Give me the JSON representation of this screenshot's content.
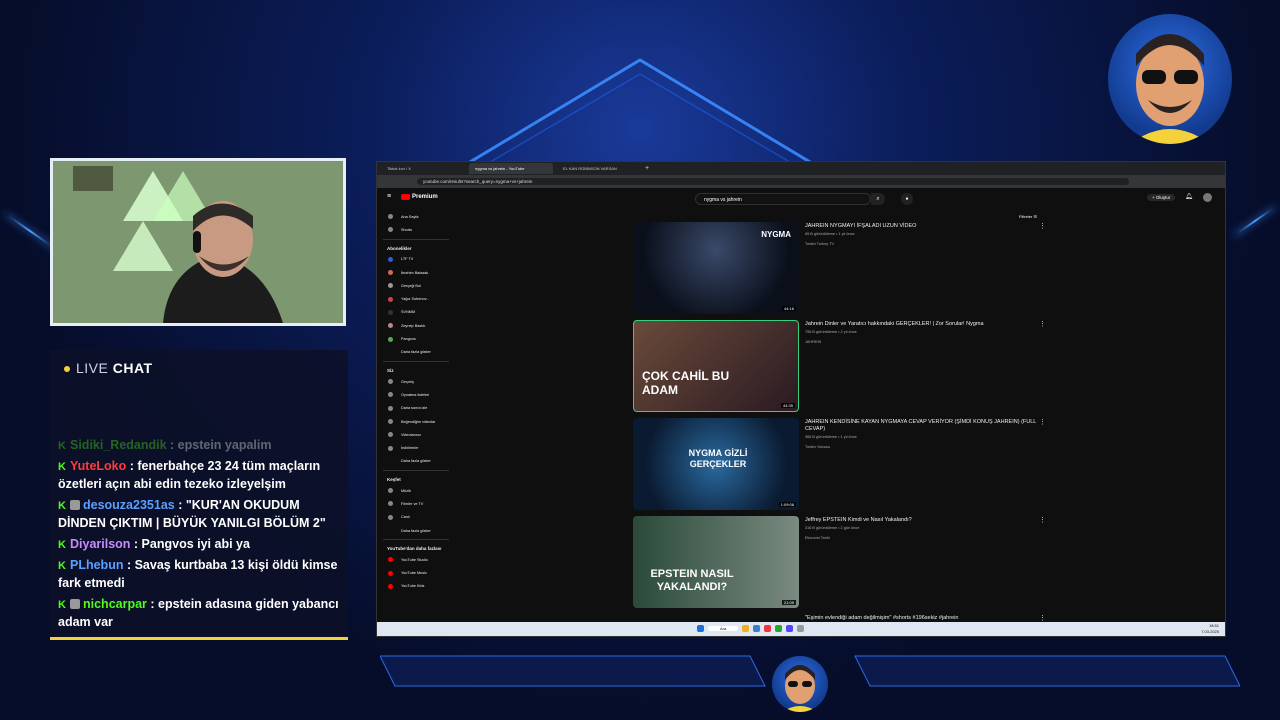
{
  "chat": {
    "header_live": "LIVE",
    "header_chat": "CHAT",
    "messages": [
      {
        "user": "Sidiki_Redandik",
        "text": ": epstein yapalim",
        "color": "#53fc18"
      },
      {
        "user": "YuteLoko",
        "text": ": fenerbahçe 23 24 tüm maçların özetleri açın abi edin tezeko izleyelşim",
        "color": "#ff3b3b"
      },
      {
        "user": "desouza2351as",
        "text": ": \"KUR'AN OKUDUM DİNDEN ÇIKTIM | BÜYÜK YANILGI BÖLÜM 2\"",
        "color": "#5aa0ff"
      },
      {
        "user": "Diyarilson",
        "text": ": Pangvos iyi abi ya",
        "color": "#c98bff"
      },
      {
        "user": "PLhebun",
        "text": ": Savaş kurtbaba 13 kişi öldü kimse fark etmedi",
        "color": "#5aa0ff"
      },
      {
        "user": "nichcarpar",
        "text": ": epstein adasına giden yabancı adam var",
        "color": "#53fc18"
      }
    ]
  },
  "browser": {
    "tabs": [
      "Tiktok kıvı / X",
      "nygma vs jahrein - YouTube",
      "EL KAN ROBINSON VARSAN"
    ],
    "url": "youtube.com/results?search_query=nygma+vs+jahrein"
  },
  "youtube": {
    "logo": "Premium",
    "search_value": "nygma vs jahrein",
    "create_label": "+ Oluştur",
    "filters_label": "Filtreler",
    "sidebar": {
      "top": [
        "Ana Sayfa",
        "Shorts"
      ],
      "subs_header": "Abonelikler",
      "subs": [
        "LTF TV",
        "İbrahim Balasak",
        "Gerçeği Bul",
        "Yağız Sobenov...",
        "SVNMM",
        "Zeynep Bastık",
        "Pangvos",
        "Daha fazla göster"
      ],
      "you_header": "Siz",
      "you": [
        "Geçmiş",
        "Oynatma listeleri",
        "Daha sonra izle",
        "Beğendiğim videolar",
        "Videolarınız",
        "İndirilenler",
        "Daha fazla göster"
      ],
      "explore_header": "Keşfet",
      "explore": [
        "Müzik",
        "Filmler ve TV",
        "Canlı",
        "Daha fazla göster"
      ],
      "more_header": "YouTube'dan daha fazlası",
      "more": [
        "YouTube Studio",
        "YouTube Music",
        "YouTube Kids"
      ]
    },
    "results": [
      {
        "title": "JAHREIN NYGMAYI İFŞALADI UZUN VİDEO",
        "meta": "65 B görüntüleme • 1 yıl önce",
        "channel": "Twitch Turkey TV",
        "duration": "44:16",
        "thumb_text": "NYGMA"
      },
      {
        "title": "Jahrein Dinler ve Yaratıcı hakkındaki GERÇEKLER! | Zor Sorular! Nygma",
        "meta": "756 B görüntüleme • 2 yıl önce",
        "channel": "JAHREIN",
        "duration": "44:35",
        "thumb_text": "ÇOK CAHİL BU ADAM"
      },
      {
        "title": "JAHREIN KENDİSİNE KAYAN NYGMAYA CEVAP VERİYOR (ŞİMDİ KONUŞ JAHREIN) (FULL CEVAP)",
        "meta": "368 B görüntüleme • 1 yıl önce",
        "channel": "Twitch Yolcusu",
        "duration": "1:09:08",
        "thumb_text": "NYGMA GİZLİ GERÇEKLER"
      },
      {
        "title": "Jeffrey EPSTEIN Kimdi ve Nasıl Yakalandı?",
        "meta": "316 B görüntüleme • 2 gün önce",
        "channel": "Ekonomi Tarihi",
        "duration": "21:09",
        "thumb_text": "EPSTEIN NASIL YAKALANDI?"
      },
      {
        "title": "\"Eşimin evlendiği adam değilmişim\" #shorts #196sekiz #jahrein",
        "meta": "",
        "channel": "",
        "duration": "",
        "thumb_text": ""
      }
    ]
  },
  "taskbar": {
    "search": "Ara",
    "time": "18:51",
    "date": "7.03.2025"
  }
}
